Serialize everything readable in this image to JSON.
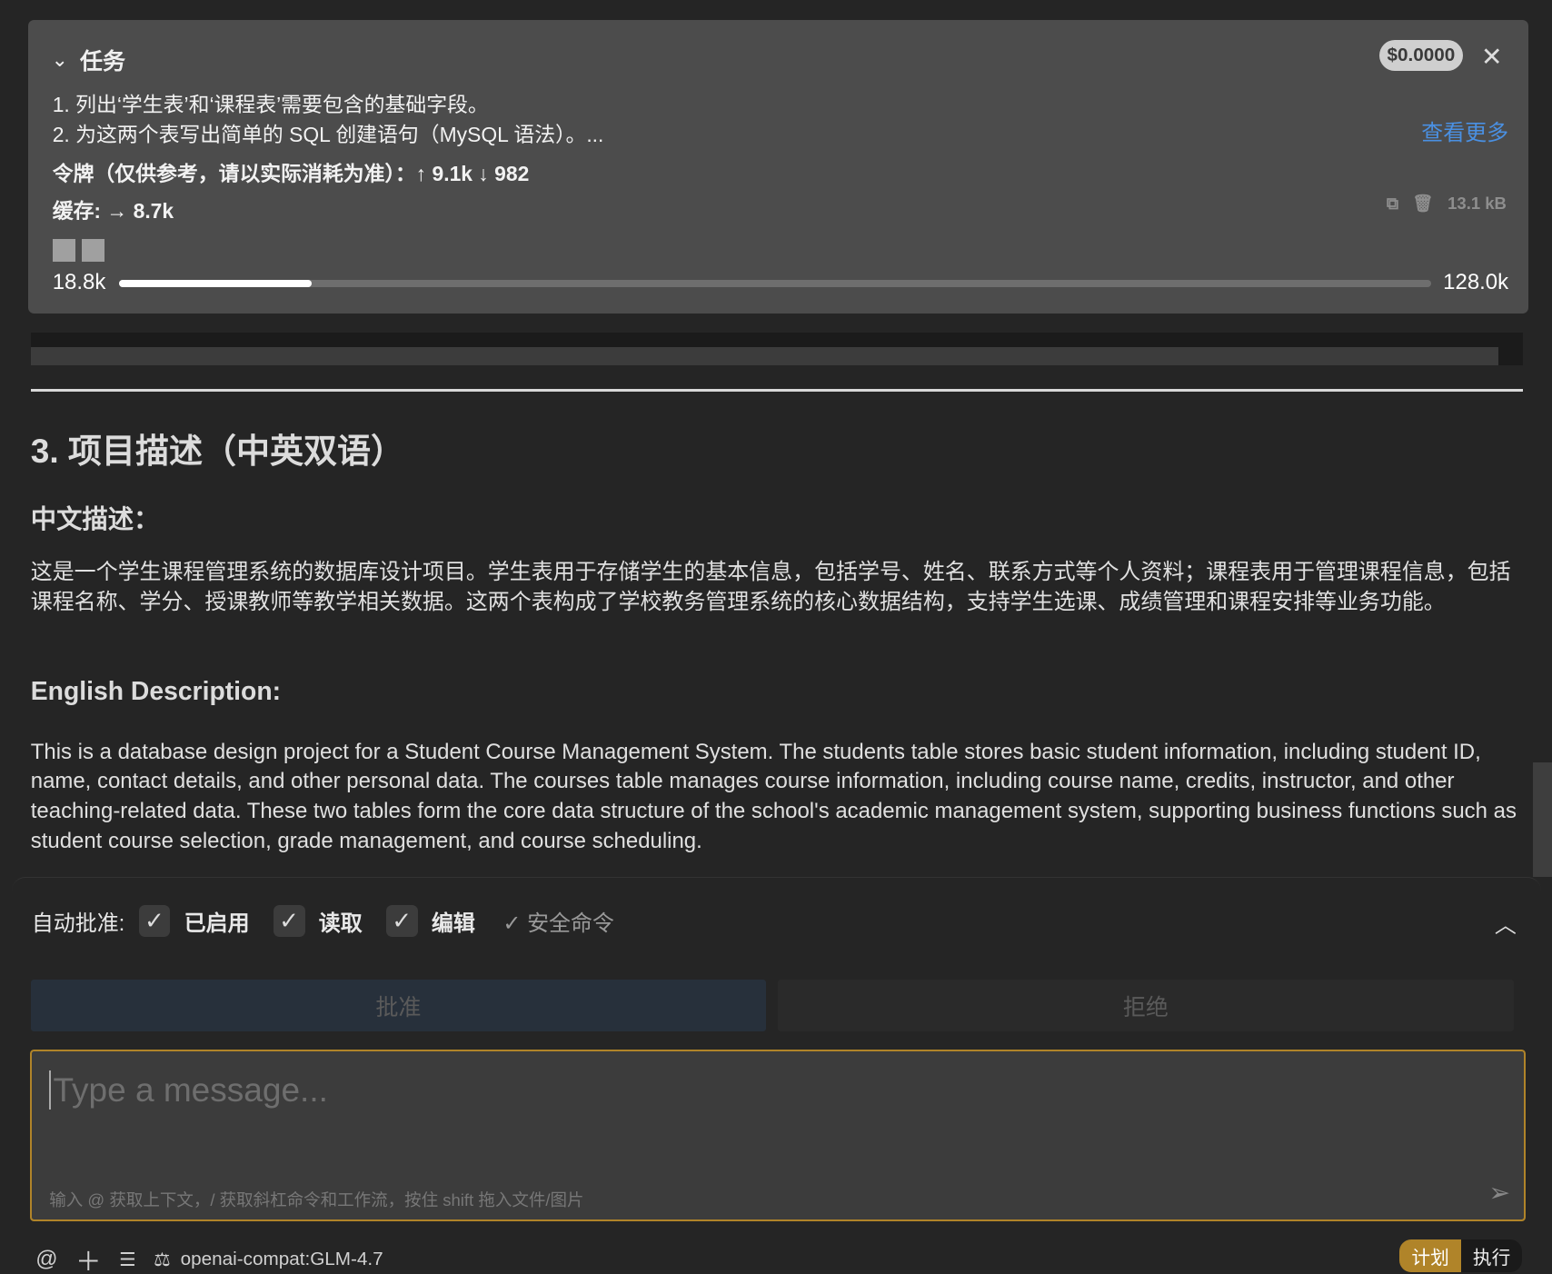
{
  "task": {
    "title": "任务",
    "cost": "$0.0000",
    "lines": [
      "1. 列出‘学生表’和‘课程表’需要包含的基础字段。",
      "2. 为这两个表写出简单的 SQL 创建语句（MySQL 语法）。..."
    ],
    "see_more": "查看更多",
    "tokens": "令牌（仅供参考，请以实际消耗为准）：↑ 9.1k ↓ 982",
    "cache": "缓存: → 8.7k",
    "size": "13.1 kB",
    "context_used": "18.8k",
    "context_max": "128.0k",
    "context_fraction": 0.147
  },
  "content": {
    "heading": "3. 项目描述（中英双语）",
    "cn_heading": "中文描述：",
    "cn_text": "这是一个学生课程管理系统的数据库设计项目。学生表用于存储学生的基本信息，包括学号、姓名、联系方式等个人资料；课程表用于管理课程信息，包括课程名称、学分、授课教师等教学相关数据。这两个表构成了学校教务管理系统的核心数据结构，支持学生选课、成绩管理和课程安排等业务功能。",
    "en_heading": "English Description:",
    "en_text": "This is a database design project for a Student Course Management System. The students table stores basic student information, including student ID, name, contact details, and other personal data. The courses table manages course information, including course name, credits, instructor, and other teaching-related data. These two tables form the core data structure of the school's academic management system, supporting business functions such as student course selection, grade management, and course scheduling."
  },
  "approval": {
    "label": "自动批准:",
    "enabled": "已启用",
    "read": "读取",
    "edit": "编辑",
    "safe": "✓ 安全命令",
    "approve": "批准",
    "reject": "拒绝"
  },
  "input": {
    "placeholder": "Type a message...",
    "hint": "输入 @ 获取上下文，/ 获取斜杠命令和工作流，按住 shift 拖入文件/图片"
  },
  "footer": {
    "model": "openai-compat:GLM-4.7",
    "plan": "计划",
    "act": "执行"
  }
}
